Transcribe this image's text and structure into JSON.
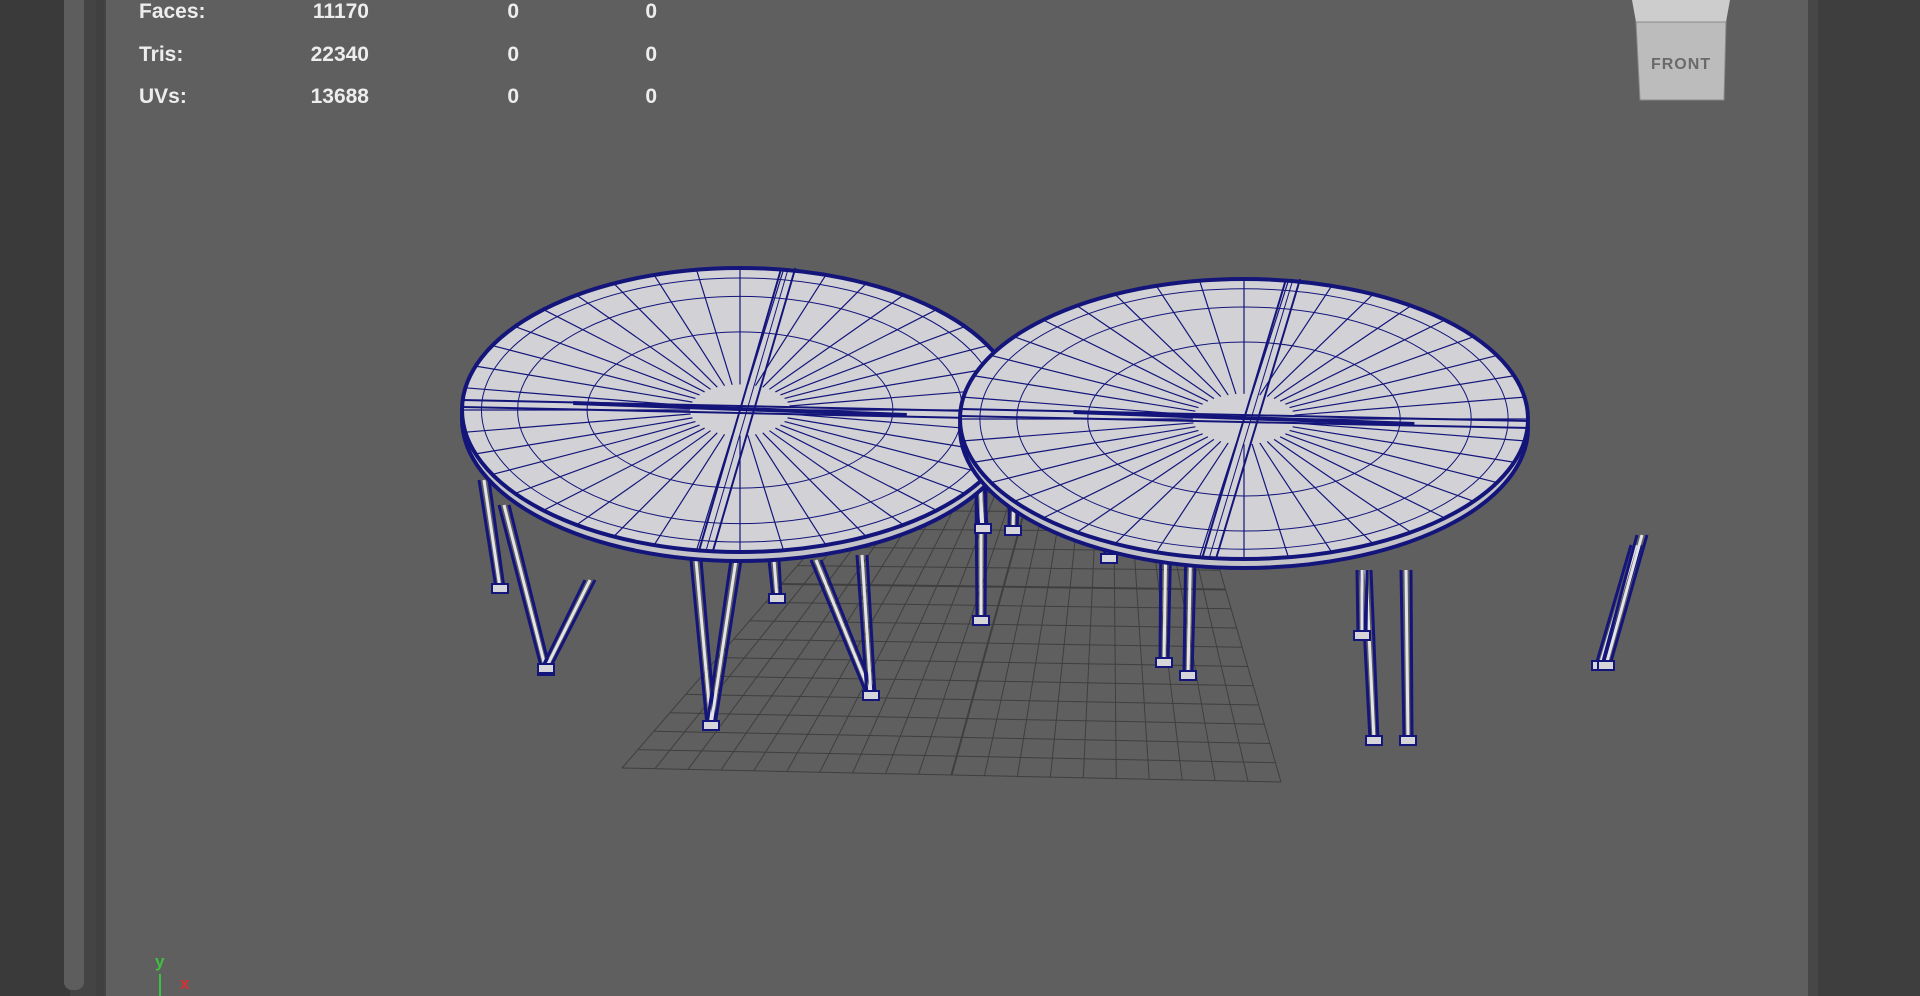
{
  "heads_up_display": {
    "rows": [
      {
        "label": "Faces:",
        "values": [
          "11170",
          "0",
          "0"
        ]
      },
      {
        "label": "Tris:",
        "values": [
          "22340",
          "0",
          "0"
        ]
      },
      {
        "label": "UVs:",
        "values": [
          "13688",
          "0",
          "0"
        ]
      }
    ]
  },
  "view_cube": {
    "label": "FRONT"
  },
  "axis_indicator": {
    "y_label": "y",
    "x_label": "x"
  },
  "colors": {
    "viewport_bg": "#5f5f5f",
    "wireframe": "#14157a",
    "table_top_fill": "#d2d2d6",
    "grid": "#3f3f3f",
    "hud_text": "#ededed",
    "axis_y": "#3ec13e",
    "axis_x": "#d83030"
  }
}
